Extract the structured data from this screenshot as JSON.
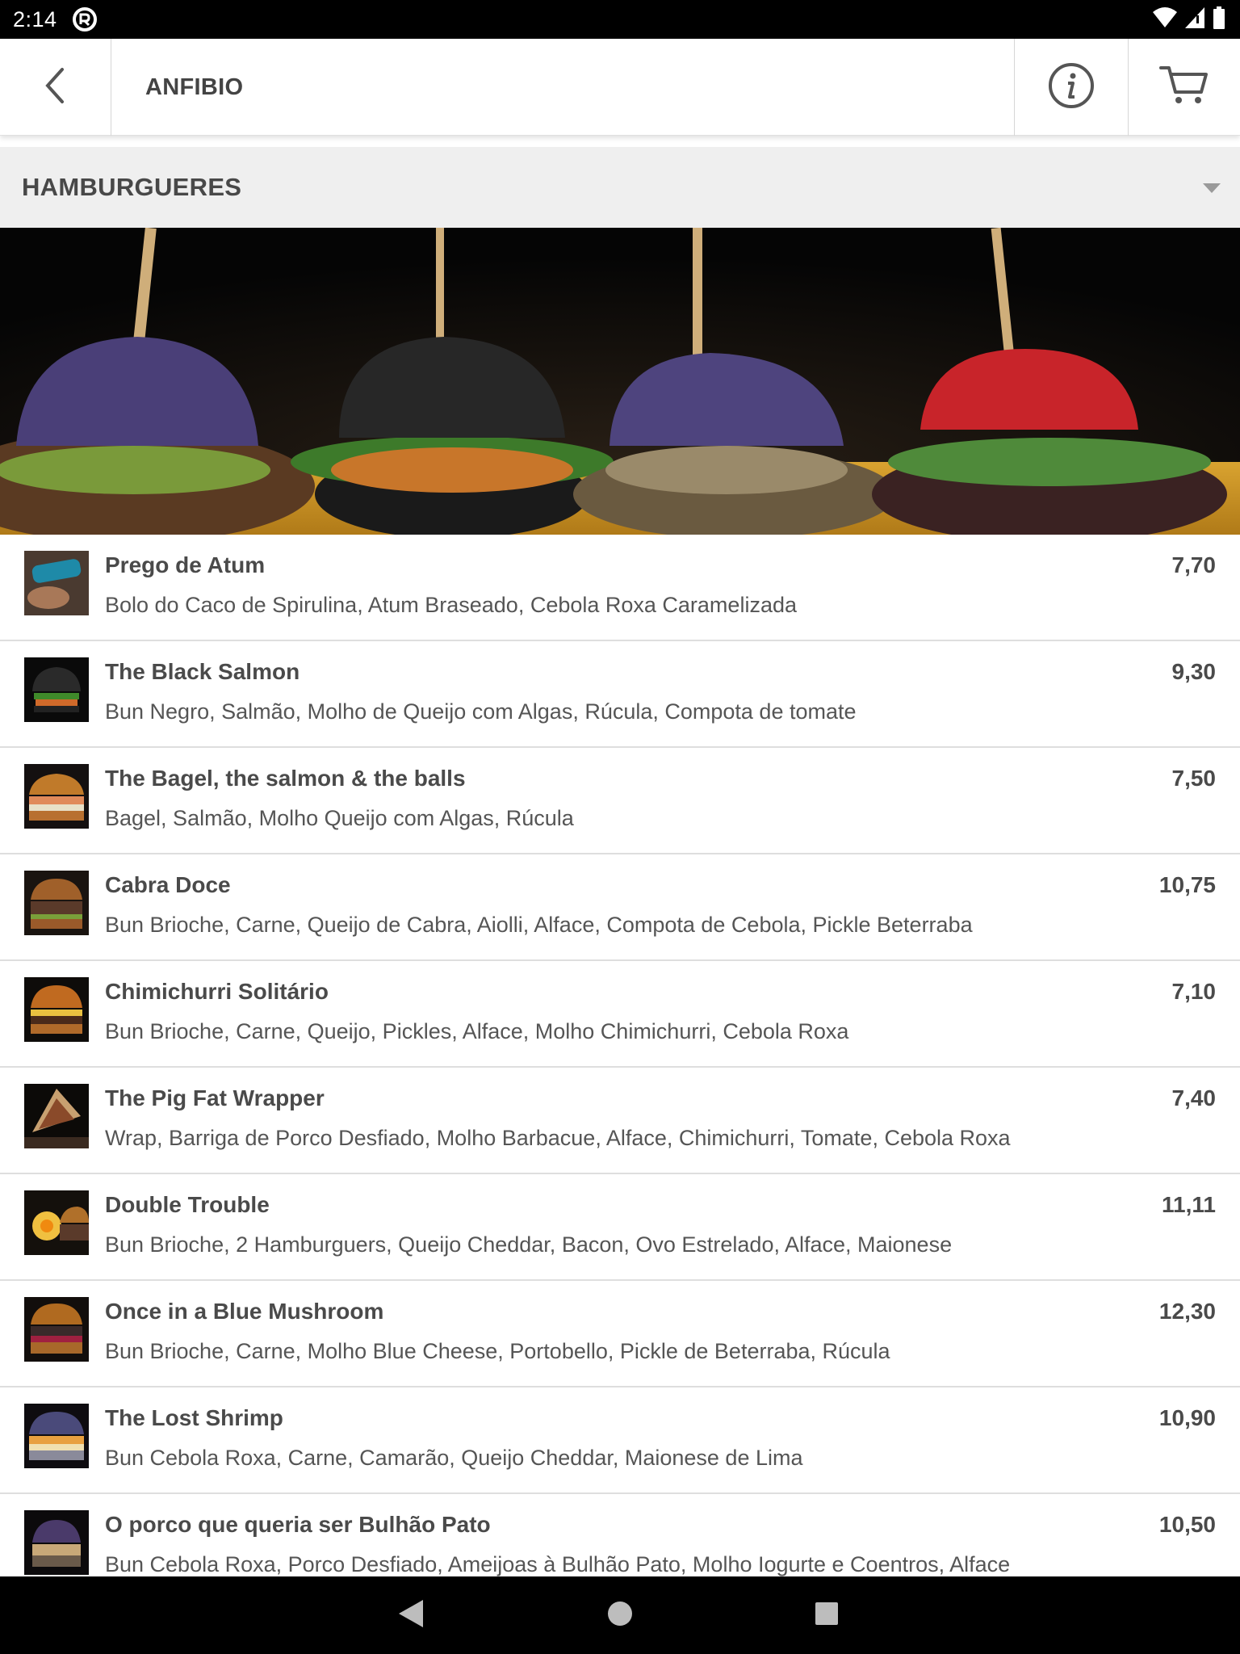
{
  "status_bar": {
    "time": "2:14"
  },
  "app_bar": {
    "title": "ANFIBIO",
    "back_icon": "chevron-left-icon",
    "info_icon": "info-icon",
    "cart_icon": "cart-icon"
  },
  "category": {
    "selected": "HAMBURGUERES"
  },
  "colors": {
    "status_bar": "#000000",
    "category_bg": "#efefef",
    "text_primary": "#4a4a4a"
  },
  "menu_items": [
    {
      "name": "Prego de Atum",
      "description": "Bolo do Caco de Spirulina, Atum Braseado, Cebola Roxa Caramelizada",
      "price": "7,70"
    },
    {
      "name": "The Black Salmon",
      "description": "Bun Negro, Salmão, Molho de Queijo com Algas, Rúcula, Compota de tomate",
      "price": "9,30"
    },
    {
      "name": "The Bagel, the salmon & the balls",
      "description": "Bagel, Salmão, Molho Queijo com Algas, Rúcula",
      "price": "7,50"
    },
    {
      "name": "Cabra Doce",
      "description": "Bun Brioche, Carne, Queijo de Cabra, Aiolli, Alface, Compota de Cebola, Pickle Beterraba",
      "price": "10,75"
    },
    {
      "name": "Chimichurri Solitário",
      "description": "Bun Brioche, Carne, Queijo, Pickles, Alface, Molho Chimichurri, Cebola Roxa",
      "price": "7,10"
    },
    {
      "name": "The Pig Fat Wrapper",
      "description": "Wrap, Barriga de Porco Desfiado, Molho Barbacue, Alface, Chimichurri, Tomate, Cebola Roxa",
      "price": "7,40"
    },
    {
      "name": "Double Trouble",
      "description": "Bun Brioche, 2 Hamburguers, Queijo Cheddar, Bacon, Ovo Estrelado, Alface, Maionese",
      "price": "11,11"
    },
    {
      "name": "Once in a Blue Mushroom",
      "description": "Bun Brioche, Carne, Molho Blue Cheese, Portobello, Pickle de Beterraba, Rúcula",
      "price": "12,30"
    },
    {
      "name": "The Lost Shrimp",
      "description": "Bun Cebola Roxa, Carne, Camarão, Queijo Cheddar, Maionese de Lima",
      "price": "10,90"
    },
    {
      "name": "O porco que queria ser Bulhão Pato",
      "description": "Bun Cebola Roxa, Porco Desfiado, Ameijoas à Bulhão Pato, Molho Iogurte e Coentros, Alface",
      "price": "10,50"
    }
  ]
}
